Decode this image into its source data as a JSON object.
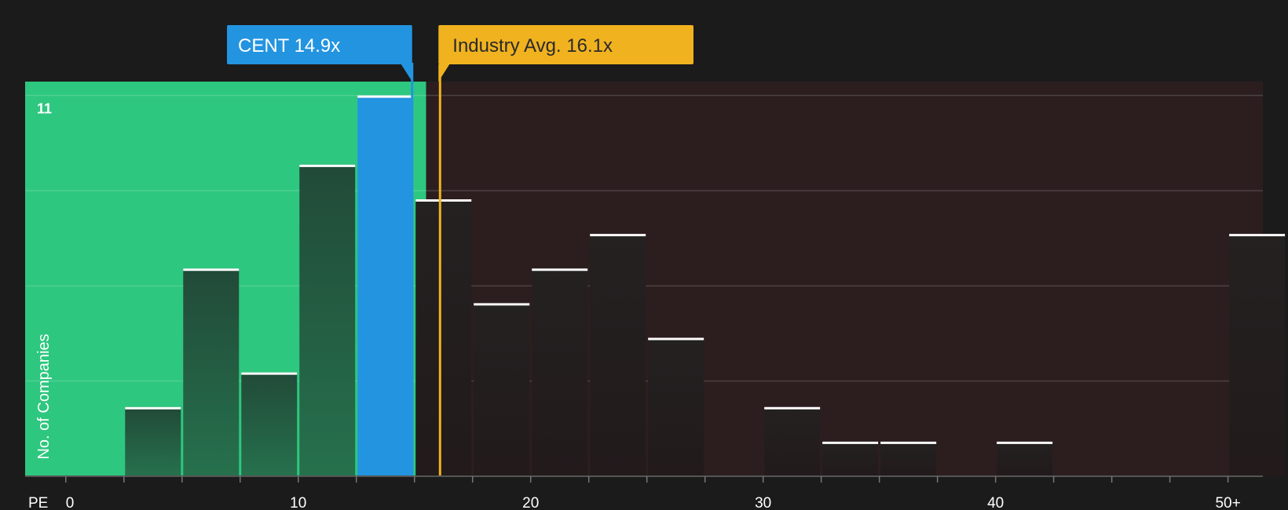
{
  "chart_data": {
    "type": "bar",
    "x_axis": {
      "label": "PE",
      "ticks": [
        {
          "value": 0,
          "label": "0"
        },
        {
          "value": 10,
          "label": "10"
        },
        {
          "value": 20,
          "label": "20"
        },
        {
          "value": 30,
          "label": "30"
        },
        {
          "value": 40,
          "label": "40"
        },
        {
          "value": 50,
          "label": "50+"
        }
      ],
      "range": [
        -1.75,
        51.5
      ]
    },
    "y_axis": {
      "label": "No. of Companies",
      "max_label": "11",
      "range": [
        0,
        11.4
      ],
      "gridlines": [
        2.75,
        5.5,
        8.25,
        11
      ]
    },
    "bins": [
      {
        "start": 2.5,
        "end": 5.0,
        "value": 2
      },
      {
        "start": 5.0,
        "end": 7.5,
        "value": 6
      },
      {
        "start": 7.5,
        "end": 10.0,
        "value": 3
      },
      {
        "start": 10.0,
        "end": 12.5,
        "value": 9
      },
      {
        "start": 12.5,
        "end": 15.0,
        "value": 11,
        "highlight": true
      },
      {
        "start": 15.0,
        "end": 17.5,
        "value": 8
      },
      {
        "start": 17.5,
        "end": 20.0,
        "value": 5
      },
      {
        "start": 20.0,
        "end": 22.5,
        "value": 6
      },
      {
        "start": 22.5,
        "end": 25.0,
        "value": 7
      },
      {
        "start": 25.0,
        "end": 27.5,
        "value": 4
      },
      {
        "start": 30.0,
        "end": 32.5,
        "value": 2
      },
      {
        "start": 32.5,
        "end": 35.0,
        "value": 1
      },
      {
        "start": 35.0,
        "end": 37.5,
        "value": 1
      },
      {
        "start": 40.0,
        "end": 42.5,
        "value": 1
      },
      {
        "start": 50.0,
        "end": 52.5,
        "value": 7
      }
    ],
    "undervalued_region": {
      "start": -1.75,
      "end": 15.5
    },
    "company": {
      "name": "CENT",
      "pe": 14.9,
      "label": "CENT 14.9x"
    },
    "industry": {
      "name": "Industry Avg.",
      "pe": 16.1,
      "label": "Industry Avg. 16.1x"
    },
    "colors": {
      "background": "#1b1b1b",
      "undervalued": "#2ec77f",
      "overvalued": "#2c1e1f",
      "company": "#2394e0",
      "industry": "#f0b21f",
      "bar_top": "#ffffff",
      "text": "#ffffff",
      "industry_text": "#2a2a2a"
    }
  }
}
